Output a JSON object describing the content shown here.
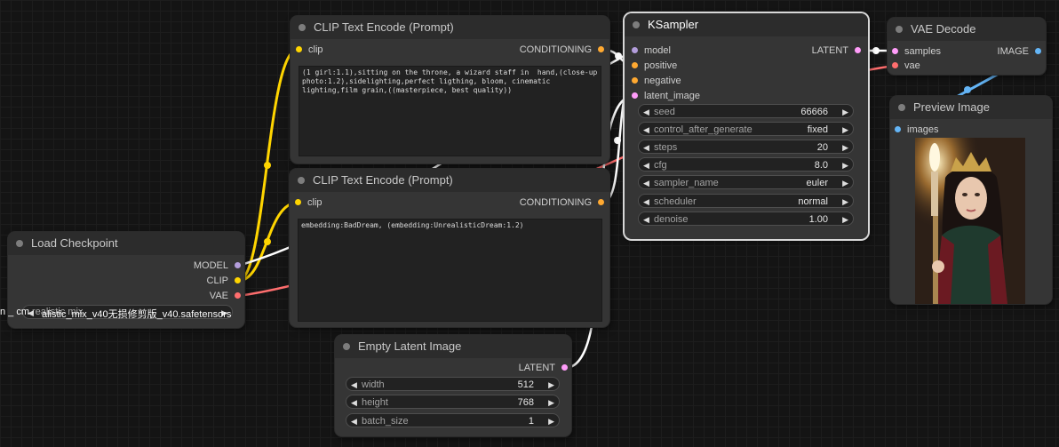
{
  "nodes": {
    "clip1": {
      "title": "CLIP Text Encode (Prompt)",
      "input": "clip",
      "output": "CONDITIONING",
      "text": "(1 girl:1.1),sitting on the throne, a wizard staff in  hand,(close-up photo:1.2),sidelighting,perfect ligthing, bloom, cinematic lighting,film grain,((masterpiece, best quality))"
    },
    "clip2": {
      "title": "CLIP Text Encode (Prompt)",
      "input": "clip",
      "output": "CONDITIONING",
      "text": "embedding:BadDream, (embedding:UnrealisticDream:1.2)"
    },
    "ksampler": {
      "title": "KSampler",
      "inputs": [
        "model",
        "positive",
        "negative",
        "latent_image"
      ],
      "output": "LATENT",
      "widgets": [
        {
          "name": "seed",
          "value": "66666"
        },
        {
          "name": "control_after_generate",
          "value": "fixed"
        },
        {
          "name": "steps",
          "value": "20"
        },
        {
          "name": "cfg",
          "value": "8.0"
        },
        {
          "name": "sampler_name",
          "value": "euler"
        },
        {
          "name": "scheduler",
          "value": "normal"
        },
        {
          "name": "denoise",
          "value": "1.00"
        }
      ]
    },
    "vae_decode": {
      "title": "VAE Decode",
      "inputs": [
        "samples",
        "vae"
      ],
      "output": "IMAGE"
    },
    "preview": {
      "title": "Preview Image",
      "input": "images"
    },
    "load_checkpoint": {
      "title": "Load Checkpoint",
      "outputs": [
        "MODEL",
        "CLIP",
        "VAE"
      ],
      "ckpt_prefix": "n _  cm",
      "ckpt_name": "alistic_mix_v40无损修剪版_v40.safetensors",
      "ckpt_overlap": "realistic mix"
    },
    "empty_latent": {
      "title": "Empty Latent Image",
      "output": "LATENT",
      "widgets": [
        {
          "name": "width",
          "value": "512"
        },
        {
          "name": "height",
          "value": "768"
        },
        {
          "name": "batch_size",
          "value": "1"
        }
      ]
    }
  },
  "colors": {
    "model": "#b39ddb",
    "clip": "#ffd500",
    "vae": "#ff6e6e",
    "conditioning": "#ffa931",
    "latent": "#ff9cf9",
    "image": "#64b5f6",
    "link_white": "#ffffff"
  }
}
